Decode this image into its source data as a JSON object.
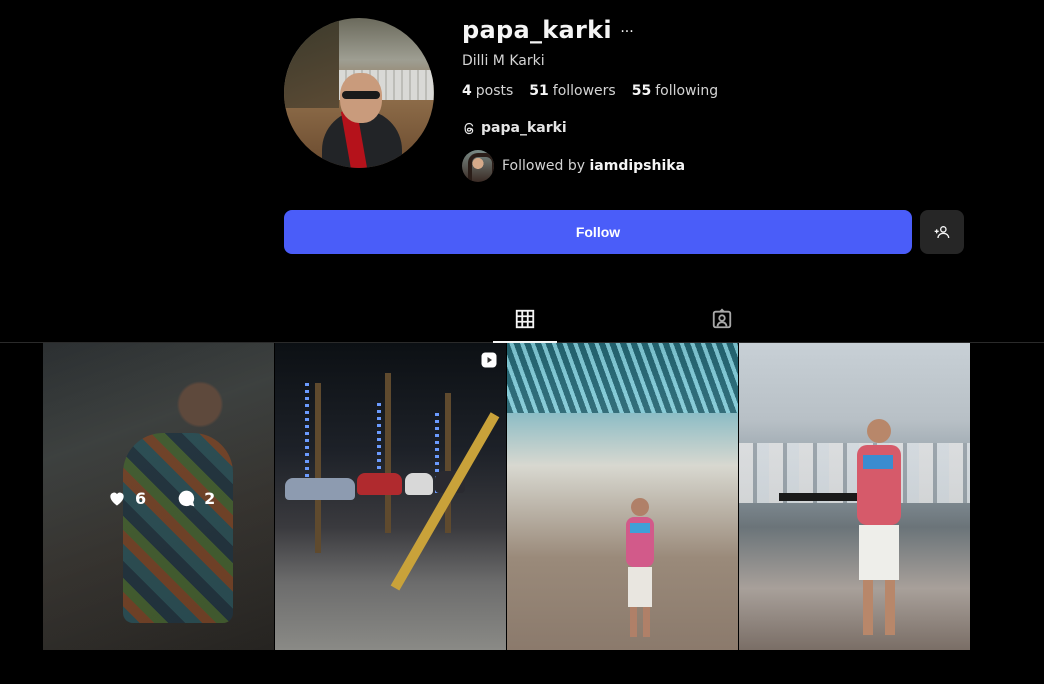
{
  "profile": {
    "username": "papa_karki",
    "more_label": "···",
    "full_name": "Dilli M Karki",
    "stats": {
      "posts_count": "4",
      "posts_label": "posts",
      "followers_count": "51",
      "followers_label": "followers",
      "following_count": "55",
      "following_label": "following"
    },
    "threads_handle": "papa_karki",
    "followed_by_prefix": "Followed by",
    "followed_by_user": "iamdipshika"
  },
  "actions": {
    "follow_label": "Follow",
    "follow_color": "#4a5df9"
  },
  "tabs": [
    {
      "name": "posts",
      "icon": "grid-icon",
      "active": true
    },
    {
      "name": "tagged",
      "icon": "tagged-user-icon",
      "active": false
    }
  ],
  "grid": {
    "posts": [
      {
        "type": "photo",
        "likes": "6",
        "comments": "2",
        "hovered": true
      },
      {
        "type": "reel",
        "icon": "reel-icon"
      },
      {
        "type": "photo"
      },
      {
        "type": "photo"
      }
    ]
  }
}
